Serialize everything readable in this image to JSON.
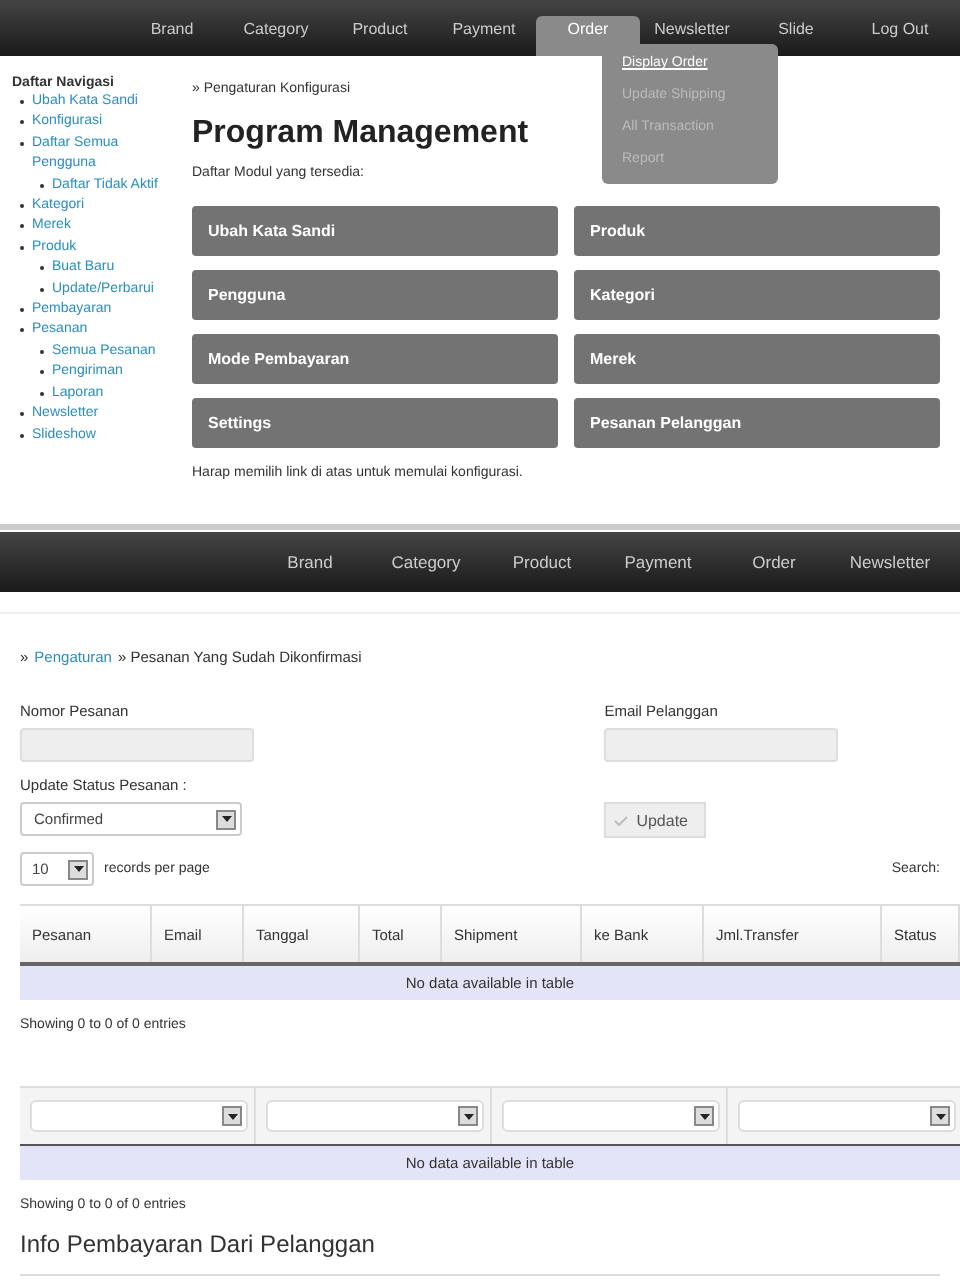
{
  "top_nav": [
    {
      "label": "Brand",
      "selected": false
    },
    {
      "label": "Category",
      "selected": false
    },
    {
      "label": "Product",
      "selected": false
    },
    {
      "label": "Payment",
      "selected": false
    },
    {
      "label": "Order",
      "selected": true
    },
    {
      "label": "Newsletter",
      "selected": false
    },
    {
      "label": "Slide",
      "selected": false
    },
    {
      "label": "Log Out",
      "selected": false
    }
  ],
  "dropdown": [
    {
      "label": "Display Order",
      "selected": true
    },
    {
      "label": "Update Shipping",
      "selected": false
    },
    {
      "label": "All Transaction",
      "selected": false
    },
    {
      "label": "Report",
      "selected": false
    }
  ],
  "sidebar": {
    "title": "Daftar Navigasi",
    "items": [
      {
        "label": "Ubah Kata Sandi"
      },
      {
        "label": "Konfigurasi"
      },
      {
        "label": "Daftar Semua Pengguna",
        "children": [
          {
            "label": "Daftar Tidak Aktif"
          }
        ]
      },
      {
        "label": "Kategori"
      },
      {
        "label": "Merek"
      },
      {
        "label": "Produk",
        "children": [
          {
            "label": "Buat Baru"
          },
          {
            "label": "Update/Perbarui"
          }
        ]
      },
      {
        "label": "Pembayaran"
      },
      {
        "label": "Pesanan",
        "children": [
          {
            "label": "Semua Pesanan"
          },
          {
            "label": "Pengiriman"
          },
          {
            "label": "Laporan"
          }
        ]
      },
      {
        "label": "Newsletter"
      },
      {
        "label": "Slideshow"
      }
    ]
  },
  "config": {
    "breadcrumb": "» Pengaturan Konfigurasi",
    "title": "Program Management",
    "subtitle": "Daftar Modul yang tersedia:",
    "modules": [
      "Ubah Kata Sandi",
      "Produk",
      "Pengguna",
      "Kategori",
      "Mode Pembayaran",
      "Merek",
      "Settings",
      "Pesanan Pelanggan"
    ],
    "note": "Harap memilih link di atas untuk memulai konfigurasi."
  },
  "second_nav": [
    {
      "label": "Brand"
    },
    {
      "label": "Category"
    },
    {
      "label": "Product"
    },
    {
      "label": "Payment"
    },
    {
      "label": "Order"
    },
    {
      "label": "Newsletter"
    }
  ],
  "orders": {
    "breadcrumb_sep": "»",
    "breadcrumb_link": "Pengaturan",
    "breadcrumb_rest": "» Pesanan Yang Sudah Dikonfirmasi",
    "order_number": {
      "label": "Nomor Pesanan"
    },
    "email": {
      "label": "Email Pelanggan"
    },
    "status": {
      "label": "Update Status Pesanan :",
      "value": "Confirmed"
    },
    "update_button": "Update",
    "page_size": "10",
    "page_size_label": "records per page",
    "search_label": "Search:",
    "columns": [
      "Pesanan",
      "Email",
      "Tanggal",
      "Total",
      "Shipment",
      "ke Bank",
      "Jml.Transfer",
      "Status"
    ],
    "empty": "No data available in table",
    "info": "Showing 0 to 0 of 0 entries",
    "empty2": "No data available in table",
    "info2": "Showing 0 to 0 of 0 entries",
    "heading": "Info Pembayaran Dari Pelanggan"
  }
}
